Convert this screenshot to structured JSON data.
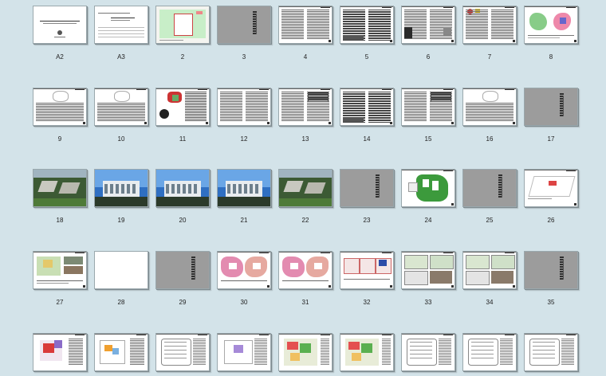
{
  "pages": [
    {
      "label": "A2",
      "kind": "cover"
    },
    {
      "label": "A3",
      "kind": "cover2"
    },
    {
      "label": "2",
      "kind": "map-green"
    },
    {
      "label": "3",
      "kind": "gray"
    },
    {
      "label": "4",
      "kind": "text"
    },
    {
      "label": "5",
      "kind": "text-dense"
    },
    {
      "label": "6",
      "kind": "text-img"
    },
    {
      "label": "7",
      "kind": "text-logo"
    },
    {
      "label": "8",
      "kind": "map-color"
    },
    {
      "label": "9",
      "kind": "text-sketch"
    },
    {
      "label": "10",
      "kind": "text-sketch"
    },
    {
      "label": "11",
      "kind": "text-red"
    },
    {
      "label": "12",
      "kind": "text"
    },
    {
      "label": "13",
      "kind": "text-table"
    },
    {
      "label": "14",
      "kind": "text-dense"
    },
    {
      "label": "15",
      "kind": "text-table"
    },
    {
      "label": "16",
      "kind": "text-sketch"
    },
    {
      "label": "17",
      "kind": "gray"
    },
    {
      "label": "18",
      "kind": "render-aerial"
    },
    {
      "label": "19",
      "kind": "render-sky"
    },
    {
      "label": "20",
      "kind": "render-sky"
    },
    {
      "label": "21",
      "kind": "render-sky"
    },
    {
      "label": "22",
      "kind": "render-aerial"
    },
    {
      "label": "23",
      "kind": "gray"
    },
    {
      "label": "24",
      "kind": "plan-green"
    },
    {
      "label": "25",
      "kind": "gray"
    },
    {
      "label": "26",
      "kind": "plan-sketch"
    },
    {
      "label": "27",
      "kind": "map-photo"
    },
    {
      "label": "28",
      "kind": "blank"
    },
    {
      "label": "29",
      "kind": "gray"
    },
    {
      "label": "30",
      "kind": "map-pink"
    },
    {
      "label": "31",
      "kind": "map-pink"
    },
    {
      "label": "32",
      "kind": "map-diagrams"
    },
    {
      "label": "33",
      "kind": "map-grid"
    },
    {
      "label": "34",
      "kind": "map-grid"
    },
    {
      "label": "35",
      "kind": "gray"
    },
    {
      "label": "",
      "kind": "plan-red"
    },
    {
      "label": "",
      "kind": "plan-orange"
    },
    {
      "label": "",
      "kind": "plan-line"
    },
    {
      "label": "",
      "kind": "plan-purple"
    },
    {
      "label": "",
      "kind": "plan-color"
    },
    {
      "label": "",
      "kind": "plan-color"
    },
    {
      "label": "",
      "kind": "plan-line"
    },
    {
      "label": "",
      "kind": "plan-line"
    },
    {
      "label": "",
      "kind": "plan-line"
    }
  ],
  "colors": {
    "background": "#d3e3e9",
    "gray_slide": "#9c9c9c",
    "ink": "#5a5a5a"
  }
}
